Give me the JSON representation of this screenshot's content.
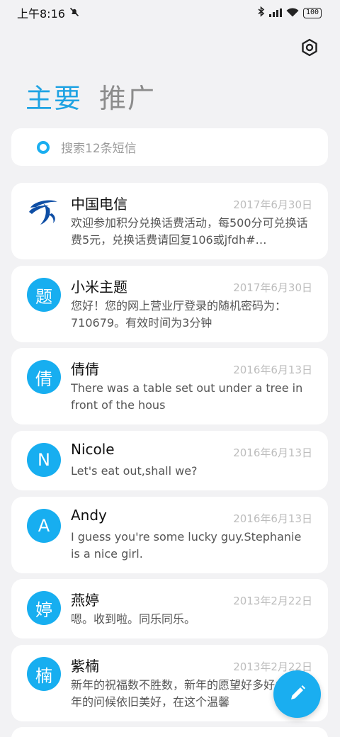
{
  "status": {
    "time": "上午8:16",
    "battery": "100"
  },
  "tabs": {
    "main": "主要",
    "promo": "推广"
  },
  "search": {
    "placeholder": "搜索12条短信"
  },
  "conversations": [
    {
      "avatar": "",
      "name": "中国电信",
      "date": "2017年6月30日",
      "preview": "欢迎参加积分兑换话费活动，每500分可兑换话费5元，兑换话费请回复106或jfdh#…"
    },
    {
      "avatar": "题",
      "name": "小米主题",
      "date": "2017年6月30日",
      "preview": "您好！您的网上营业厅登录的随机密码为：710679。有效时间为3分钟"
    },
    {
      "avatar": "倩",
      "name": "倩倩",
      "date": "2016年6月13日",
      "preview": "There was a table set out under a tree in front of the hous"
    },
    {
      "avatar": "N",
      "name": "Nicole",
      "date": "2016年6月13日",
      "preview": "Let's eat out,shall we?"
    },
    {
      "avatar": "A",
      "name": "Andy",
      "date": "2016年6月13日",
      "preview": "I guess you're some lucky guy.Stephanie is a nice girl."
    },
    {
      "avatar": "婷",
      "name": "燕婷",
      "date": "2013年2月22日",
      "preview": "嗯。收到啦。同乐同乐。"
    },
    {
      "avatar": "楠",
      "name": "紫楠",
      "date": "2013年2月22日",
      "preview": "新年的祝福数不胜数，新年的愿望好多好多，新年的问候依旧美好，在这个温馨"
    },
    {
      "avatar": "",
      "name": "",
      "date": "",
      "preview": ""
    }
  ],
  "colors": {
    "accent": "#1aaef0",
    "tab_active": "#1fa3e3",
    "background": "#f2f2f4"
  },
  "icons": {
    "settings": "hexagon-gear-icon",
    "compose": "pencil-icon",
    "search": "search-ring-icon"
  }
}
